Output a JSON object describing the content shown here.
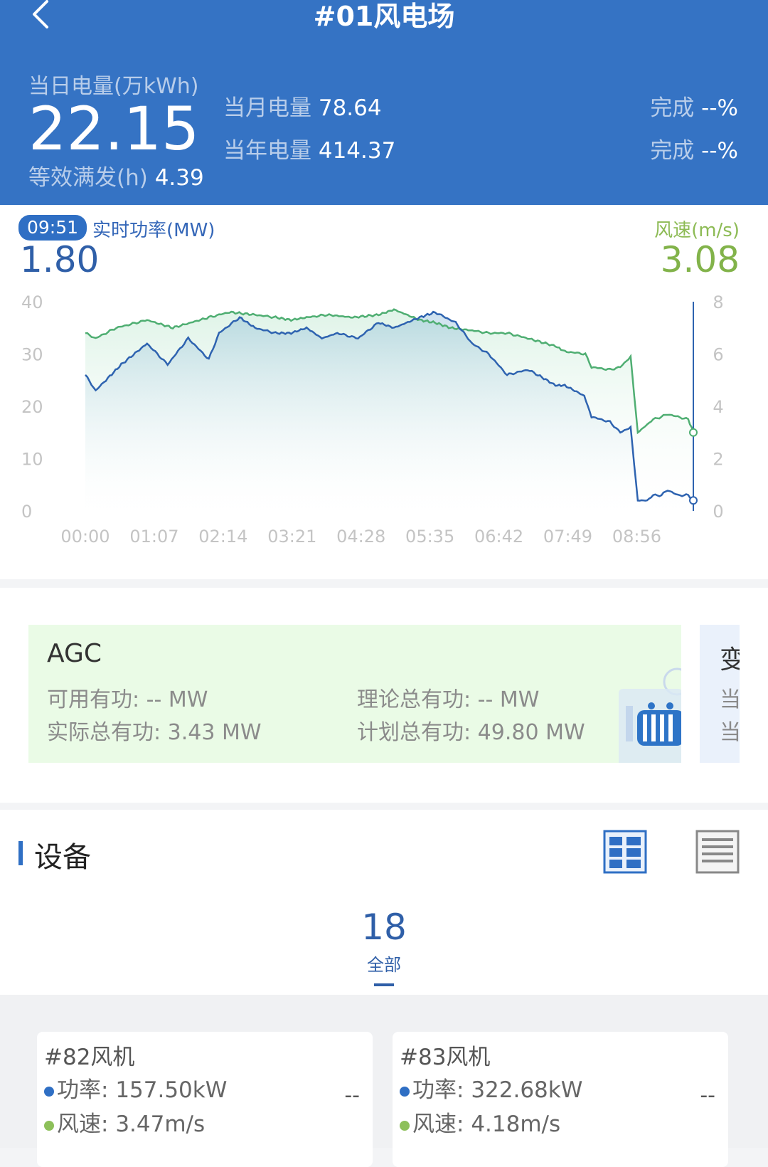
{
  "header": {
    "title": "#01风电场",
    "day_energy_label": "当日电量(万kWh)",
    "day_energy_value": "22.15",
    "equiv_hours_label": "等效满发(h)",
    "equiv_hours_value": "4.39",
    "month_energy_label": "当月电量",
    "month_energy_value": "78.64",
    "year_energy_label": "当年电量",
    "year_energy_value": "414.37",
    "completion_label": "完成",
    "month_completion_value": "--%",
    "year_completion_value": "--%"
  },
  "realtime": {
    "time_badge": "09:51",
    "power_label": "实时功率(MW)",
    "power_value": "1.80",
    "wind_label": "风速(m/s)",
    "wind_value": "3.08"
  },
  "chart_data": {
    "type": "line",
    "x_ticks": [
      "00:00",
      "01:07",
      "02:14",
      "03:21",
      "04:28",
      "05:35",
      "06:42",
      "07:49",
      "08:56"
    ],
    "y_left_ticks": [
      "0",
      "10",
      "20",
      "30",
      "40"
    ],
    "y_right_ticks": [
      "0",
      "2",
      "4",
      "6",
      "8"
    ],
    "ylim_left": [
      0,
      40
    ],
    "ylim_right": [
      0,
      8
    ],
    "x_range_minutes": [
      0,
      591
    ],
    "grid": false,
    "colors": {
      "power": "#2e63b0",
      "wind": "#4fae72"
    },
    "series": [
      {
        "axis": "left",
        "x_minutes": [
          0,
          10,
          20,
          35,
          60,
          80,
          100,
          120,
          130,
          150,
          165,
          185,
          200,
          215,
          230,
          245,
          265,
          285,
          300,
          325,
          340,
          360,
          376,
          392,
          410,
          430,
          440,
          457,
          466,
          485,
          492,
          510,
          520,
          530,
          537,
          546,
          552,
          560,
          566,
          576,
          586,
          591
        ],
        "values": [
          26,
          23,
          25,
          28,
          32,
          28,
          33,
          29,
          34,
          37,
          35,
          34,
          34,
          35,
          33,
          34,
          33,
          36,
          35,
          37,
          38,
          36,
          32,
          30,
          26,
          27,
          26,
          24,
          24,
          22,
          18,
          17,
          15,
          16,
          2,
          2,
          3,
          3,
          4,
          3,
          3,
          2
        ]
      },
      {
        "axis": "right",
        "x_minutes": [
          0,
          10,
          30,
          60,
          85,
          120,
          140,
          165,
          185,
          200,
          215,
          235,
          260,
          285,
          300,
          325,
          340,
          355,
          376,
          392,
          410,
          430,
          457,
          466,
          486,
          492,
          510,
          520,
          530,
          537,
          546,
          552,
          560,
          566,
          576,
          586,
          591
        ],
        "values": [
          6.8,
          6.6,
          7.0,
          7.3,
          7.0,
          7.4,
          7.6,
          7.5,
          7.4,
          7.3,
          7.4,
          7.5,
          7.4,
          7.5,
          7.7,
          7.3,
          7.2,
          7.0,
          6.9,
          6.8,
          6.8,
          6.6,
          6.3,
          6.1,
          6.0,
          5.5,
          5.4,
          5.5,
          5.9,
          3.0,
          3.3,
          3.5,
          3.6,
          3.7,
          3.6,
          3.5,
          3.0
        ]
      }
    ]
  },
  "agc": {
    "title": "AGC",
    "available_label": "可用有功:",
    "available_value": "-- MW",
    "theory_label": "理论总有功:",
    "theory_value": "-- MW",
    "actual_label": "实际总有功:",
    "actual_value": "3.43 MW",
    "plan_label": "计划总有功:",
    "plan_value": "49.80 MW"
  },
  "agc2": {
    "title": "变",
    "line1": "当",
    "line2": "当"
  },
  "equipment": {
    "title": "设备",
    "tab_count": "18",
    "tab_label": "全部",
    "grid_view_icon": "grid-view-icon",
    "list_view_icon": "list-view-icon"
  },
  "turbines": [
    {
      "name": "#82风机",
      "power_label": "功率:",
      "power_value": "157.50kW",
      "wind_label": "风速:",
      "wind_value": "3.47m/s",
      "status": "--"
    },
    {
      "name": "#83风机",
      "power_label": "功率:",
      "power_value": "322.68kW",
      "wind_label": "风速:",
      "wind_value": "4.18m/s",
      "status": "--"
    }
  ]
}
